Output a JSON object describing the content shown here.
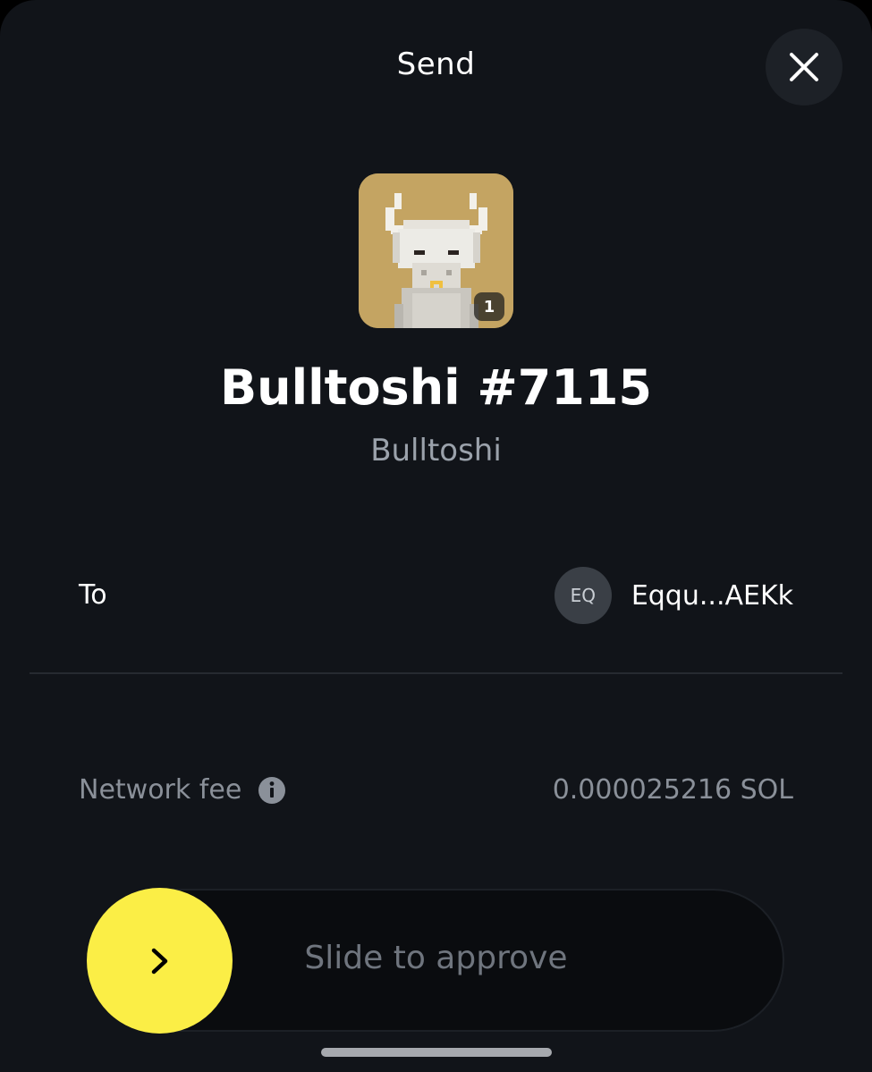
{
  "header": {
    "title": "Send",
    "close_icon": "close-icon"
  },
  "nft": {
    "name": "Bulltoshi #7115",
    "collection": "Bulltoshi",
    "quantity": "1",
    "image_background": "#c4a462"
  },
  "recipient": {
    "label": "To",
    "avatar_initials": "EQ",
    "address": "Eqqu...AEKk"
  },
  "fee": {
    "label": "Network fee",
    "value": "0.000025216 SOL",
    "info_icon": "info-icon"
  },
  "slider": {
    "label": "Slide to approve",
    "handle_icon": "chevron-right-icon",
    "handle_color": "#fbee46"
  },
  "colors": {
    "background": "#111419",
    "accent": "#fbee46",
    "muted_text": "#8a9099"
  }
}
